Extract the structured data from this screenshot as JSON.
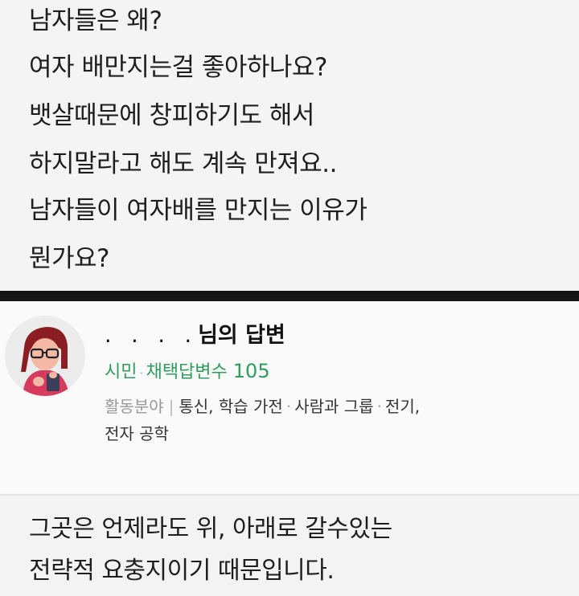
{
  "question": {
    "lines": [
      "남자들은 왜?",
      "여자 배만지는걸 좋아하나요?",
      "뱃살때문에 창피하기도 해서",
      "하지말라고 해도 계속 만져요..",
      "남자들이 여자배를 만지는 이유가",
      "뭔가요?"
    ]
  },
  "answerer": {
    "name_suffix": "님의 답변",
    "rank": "시민",
    "adopted_label": "채택답변수",
    "adopted_count": "105",
    "fields_label": "활동분야",
    "fields": [
      "통신, 학습 가전",
      "사람과 그룹",
      "전기,",
      "전자 공학"
    ]
  },
  "answer": {
    "lines": [
      "그곳은 언제라도 위, 아래로 갈수있는",
      "전략적 요충지이기 때문입니다."
    ]
  },
  "colors": {
    "accent_green": "#2e9e5a",
    "divider": "#151515"
  }
}
